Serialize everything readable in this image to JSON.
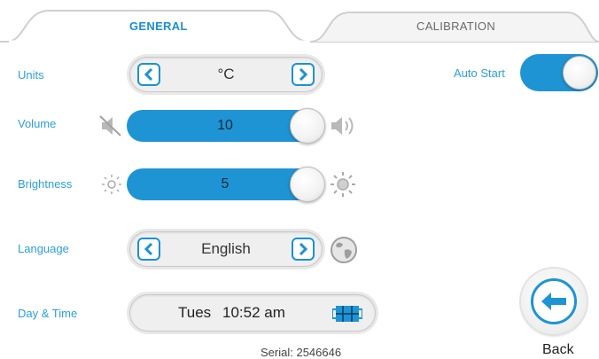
{
  "tabs": [
    {
      "label": "GENERAL",
      "active": true
    },
    {
      "label": "CALIBRATION",
      "active": false
    }
  ],
  "settings": {
    "units": {
      "label": "Units",
      "value": "°C"
    },
    "volume": {
      "label": "Volume",
      "value": "10",
      "level": 1.0
    },
    "brightness": {
      "label": "Brightness",
      "value": "5",
      "level": 1.0
    },
    "language": {
      "label": "Language",
      "value": "English"
    },
    "datetime": {
      "label": "Day & Time",
      "day": "Tues",
      "time": "10:52 am"
    }
  },
  "auto_start": {
    "label": "Auto Start",
    "on": true
  },
  "serial": "Serial: 2546646",
  "back": {
    "label": "Back"
  },
  "colors": {
    "accent": "#1e94d4",
    "label": "#2aa0dc",
    "tab_active": "#1a8fd0"
  },
  "icons": [
    "chevron-left-icon",
    "chevron-right-icon",
    "speaker-mute-icon",
    "speaker-loud-icon",
    "sun-dim-icon",
    "sun-bright-icon",
    "globe-icon",
    "calendar-icon",
    "arrow-left-icon"
  ]
}
